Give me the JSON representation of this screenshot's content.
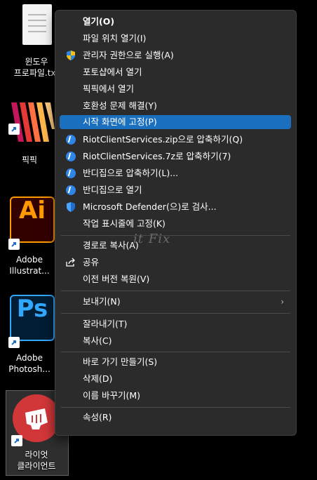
{
  "desktop": {
    "icons": [
      {
        "label1": "윈도우",
        "label2": "프로파일.txt"
      },
      {
        "label1": "픽픽"
      },
      {
        "label1": "Adobe",
        "label2": "Illustrat..."
      },
      {
        "label1": "Adobe",
        "label2": "Photosh..."
      },
      {
        "label1": "라이엇",
        "label2": "클라이언트"
      }
    ],
    "tiles": {
      "ai": "Ai",
      "ps": "Ps"
    }
  },
  "menu": {
    "items": [
      {
        "label": "열기(O)",
        "icon": ""
      },
      {
        "label": "파일 위치 열기(I)",
        "icon": ""
      },
      {
        "label": "관리자 권한으로 실행(A)",
        "icon": "uac-shield-icon"
      },
      {
        "label": "포토샵에서 열기",
        "icon": ""
      },
      {
        "label": "픽픽에서 열기",
        "icon": ""
      },
      {
        "label": "호환성 문제 해결(Y)",
        "icon": ""
      },
      {
        "label": "시작 화면에 고정(P)",
        "icon": ""
      },
      {
        "label": "RiotClientServices.zip으로 압축하기(Q)",
        "icon": "bandizip-icon"
      },
      {
        "label": "RiotClientServices.7z로 압축하기(7)",
        "icon": "bandizip-icon"
      },
      {
        "label": "반디집으로 압축하기(L)...",
        "icon": "bandizip-icon"
      },
      {
        "label": "반디집으로 열기",
        "icon": "bandizip-icon"
      },
      {
        "label": "Microsoft Defender(으)로 검사...",
        "icon": "defender-shield-icon"
      },
      {
        "label": "작업 표시줄에 고정(K)",
        "icon": ""
      },
      {
        "label": "경로로 복사(A)",
        "icon": ""
      },
      {
        "label": "공유",
        "icon": "share-icon"
      },
      {
        "label": "이전 버전 복원(V)",
        "icon": ""
      },
      {
        "label": "보내기(N)",
        "icon": "chevron-right-icon"
      },
      {
        "label": "잘라내기(T)",
        "icon": ""
      },
      {
        "label": "복사(C)",
        "icon": ""
      },
      {
        "label": "바로 가기 만들기(S)",
        "icon": ""
      },
      {
        "label": "삭제(D)",
        "icon": ""
      },
      {
        "label": "이름 바꾸기(M)",
        "icon": ""
      },
      {
        "label": "속성(R)",
        "icon": ""
      }
    ]
  },
  "watermark": "it Fix",
  "colors": {
    "highlight": "#1b6fbf",
    "menu_bg": "#2b2b2b"
  }
}
